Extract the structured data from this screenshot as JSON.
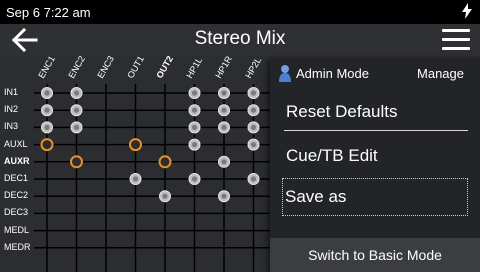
{
  "status": {
    "time": "Sep 6 7:22 am",
    "charging_icon": "bolt-icon"
  },
  "appbar": {
    "title": "Stereo Mix",
    "back_icon": "arrow-left-icon",
    "menu_icon": "hamburger-icon"
  },
  "matrix": {
    "columns": [
      "ENC1",
      "ENC2",
      "ENC3",
      "OUT1",
      "OUT2",
      "HP1L",
      "HP1R",
      "HP2L"
    ],
    "bold_columns": [
      "OUT2"
    ],
    "rows": [
      "IN1",
      "IN2",
      "IN3",
      "AUXL",
      "AUXR",
      "DEC1",
      "DEC2",
      "DEC3",
      "MEDL",
      "MEDR"
    ],
    "bold_rows": [
      "AUXR"
    ],
    "colors": {
      "grid": "#000000",
      "node_gray": "#bdbdbd",
      "node_orange": "#e8902a"
    },
    "nodes": [
      {
        "row": "IN1",
        "col": "ENC1",
        "color": "gray"
      },
      {
        "row": "IN1",
        "col": "ENC2",
        "color": "gray"
      },
      {
        "row": "IN1",
        "col": "HP1L",
        "color": "gray"
      },
      {
        "row": "IN1",
        "col": "HP1R",
        "color": "gray"
      },
      {
        "row": "IN1",
        "col": "HP2L",
        "color": "gray"
      },
      {
        "row": "IN2",
        "col": "ENC1",
        "color": "gray"
      },
      {
        "row": "IN2",
        "col": "ENC2",
        "color": "gray"
      },
      {
        "row": "IN2",
        "col": "HP1L",
        "color": "gray"
      },
      {
        "row": "IN2",
        "col": "HP1R",
        "color": "gray"
      },
      {
        "row": "IN2",
        "col": "HP2L",
        "color": "gray"
      },
      {
        "row": "IN3",
        "col": "ENC1",
        "color": "gray"
      },
      {
        "row": "IN3",
        "col": "ENC2",
        "color": "gray"
      },
      {
        "row": "IN3",
        "col": "HP1L",
        "color": "gray"
      },
      {
        "row": "IN3",
        "col": "HP1R",
        "color": "gray"
      },
      {
        "row": "IN3",
        "col": "HP2L",
        "color": "gray"
      },
      {
        "row": "AUXL",
        "col": "ENC1",
        "color": "orange"
      },
      {
        "row": "AUXL",
        "col": "OUT1",
        "color": "orange"
      },
      {
        "row": "AUXL",
        "col": "HP1L",
        "color": "gray"
      },
      {
        "row": "AUXL",
        "col": "HP2L",
        "color": "gray"
      },
      {
        "row": "AUXR",
        "col": "ENC2",
        "color": "orange"
      },
      {
        "row": "AUXR",
        "col": "OUT2",
        "color": "orange"
      },
      {
        "row": "AUXR",
        "col": "HP1R",
        "color": "gray"
      },
      {
        "row": "DEC1",
        "col": "OUT1",
        "color": "gray"
      },
      {
        "row": "DEC1",
        "col": "HP1L",
        "color": "gray"
      },
      {
        "row": "DEC1",
        "col": "HP2L",
        "color": "gray"
      },
      {
        "row": "DEC2",
        "col": "OUT2",
        "color": "gray"
      },
      {
        "row": "DEC2",
        "col": "HP1R",
        "color": "gray"
      }
    ]
  },
  "menu": {
    "admin_icon": "person-icon",
    "admin_label": "Admin Mode",
    "manage_label": "Manage",
    "items": [
      "Reset Defaults",
      "Cue/TB Edit",
      "Save as"
    ],
    "footer": "Switch to Basic Mode"
  }
}
